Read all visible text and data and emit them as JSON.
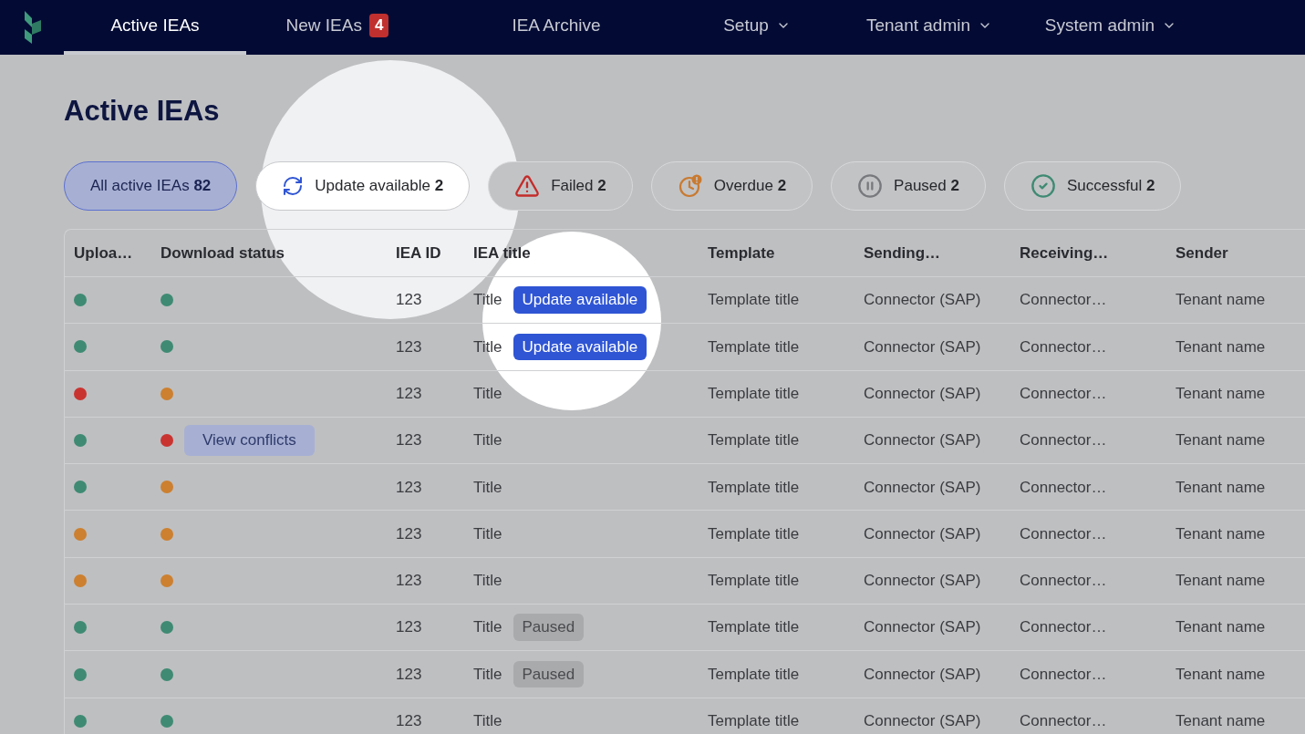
{
  "nav": {
    "items": [
      {
        "label": "Active IEAs",
        "selected": true,
        "has_menu": false
      },
      {
        "label": "New IEAs",
        "selected": false,
        "has_menu": false,
        "badge": "4"
      },
      {
        "label": "IEA Archive",
        "selected": false,
        "has_menu": false
      },
      {
        "label": "Setup",
        "selected": false,
        "has_menu": true
      },
      {
        "label": "Tenant admin",
        "selected": false,
        "has_menu": true
      },
      {
        "label": "System admin",
        "selected": false,
        "has_menu": true
      }
    ]
  },
  "page_title": "Active IEAs",
  "filters": [
    {
      "kind": "all",
      "label": "All active IEAs",
      "count": "82",
      "selected": true
    },
    {
      "kind": "update",
      "label": "Update available",
      "count": "2",
      "selected": false
    },
    {
      "kind": "failed",
      "label": "Failed",
      "count": "2",
      "selected": false
    },
    {
      "kind": "overdue",
      "label": "Overdue",
      "count": "2",
      "selected": false
    },
    {
      "kind": "paused",
      "label": "Paused",
      "count": "2",
      "selected": false
    },
    {
      "kind": "successful",
      "label": "Successful",
      "count": "2",
      "selected": false
    }
  ],
  "table": {
    "columns": [
      "Uploa…",
      "Download status",
      "IEA ID",
      "IEA title",
      "Template",
      "Sending…",
      "Receiving…",
      "Sender"
    ],
    "rows": [
      {
        "upload": {
          "color": "#3f8a73"
        },
        "download": {
          "color": "#3f8a73"
        },
        "iea_id": "123",
        "title": "Title",
        "tag": {
          "kind": "update",
          "label": "Update available"
        },
        "template": "Template title",
        "sending": "Connector (SAP)",
        "receiving": "Connector…",
        "sender": "Tenant name"
      },
      {
        "upload": {
          "color": "#3f8a73"
        },
        "download": {
          "color": "#3f8a73"
        },
        "iea_id": "123",
        "title": "Title",
        "tag": {
          "kind": "update",
          "label": "Update available"
        },
        "template": "Template title",
        "sending": "Connector (SAP)",
        "receiving": "Connector…",
        "sender": "Tenant name"
      },
      {
        "upload": {
          "color": "#c93431"
        },
        "download": {
          "color": "#cc8030"
        },
        "iea_id": "123",
        "title": "Title",
        "template": "Template title",
        "sending": "Connector (SAP)",
        "receiving": "Connector…",
        "sender": "Tenant name"
      },
      {
        "upload": {
          "color": "#3f8a73"
        },
        "download": {
          "color": "#c93431"
        },
        "action": "View conflicts",
        "iea_id": "123",
        "title": "Title",
        "template": "Template title",
        "sending": "Connector (SAP)",
        "receiving": "Connector…",
        "sender": "Tenant name"
      },
      {
        "upload": {
          "color": "#3f8a73"
        },
        "download": {
          "color": "#cc8030"
        },
        "iea_id": "123",
        "title": "Title",
        "template": "Template title",
        "sending": "Connector (SAP)",
        "receiving": "Connector…",
        "sender": "Tenant name"
      },
      {
        "upload": {
          "color": "#cc8030"
        },
        "download": {
          "color": "#cc8030"
        },
        "iea_id": "123",
        "title": "Title",
        "template": "Template title",
        "sending": "Connector (SAP)",
        "receiving": "Connector…",
        "sender": "Tenant name"
      },
      {
        "upload": {
          "color": "#cc8030"
        },
        "download": {
          "color": "#cc8030"
        },
        "iea_id": "123",
        "title": "Title",
        "template": "Template title",
        "sending": "Connector (SAP)",
        "receiving": "Connector…",
        "sender": "Tenant name"
      },
      {
        "upload": {
          "color": "#3f8a73"
        },
        "download": {
          "color": "#3f8a73"
        },
        "iea_id": "123",
        "title": "Title",
        "tag": {
          "kind": "paused",
          "label": "Paused"
        },
        "template": "Template title",
        "sending": "Connector (SAP)",
        "receiving": "Connector…",
        "sender": "Tenant name"
      },
      {
        "upload": {
          "color": "#3f8a73"
        },
        "download": {
          "color": "#3f8a73"
        },
        "iea_id": "123",
        "title": "Title",
        "tag": {
          "kind": "paused",
          "label": "Paused"
        },
        "template": "Template title",
        "sending": "Connector (SAP)",
        "receiving": "Connector…",
        "sender": "Tenant name"
      },
      {
        "upload": {
          "color": "#3f8a73"
        },
        "download": {
          "color": "#3f8a73"
        },
        "iea_id": "123",
        "title": "Title",
        "template": "Template title",
        "sending": "Connector (SAP)",
        "receiving": "Connector…",
        "sender": "Tenant name"
      }
    ]
  }
}
